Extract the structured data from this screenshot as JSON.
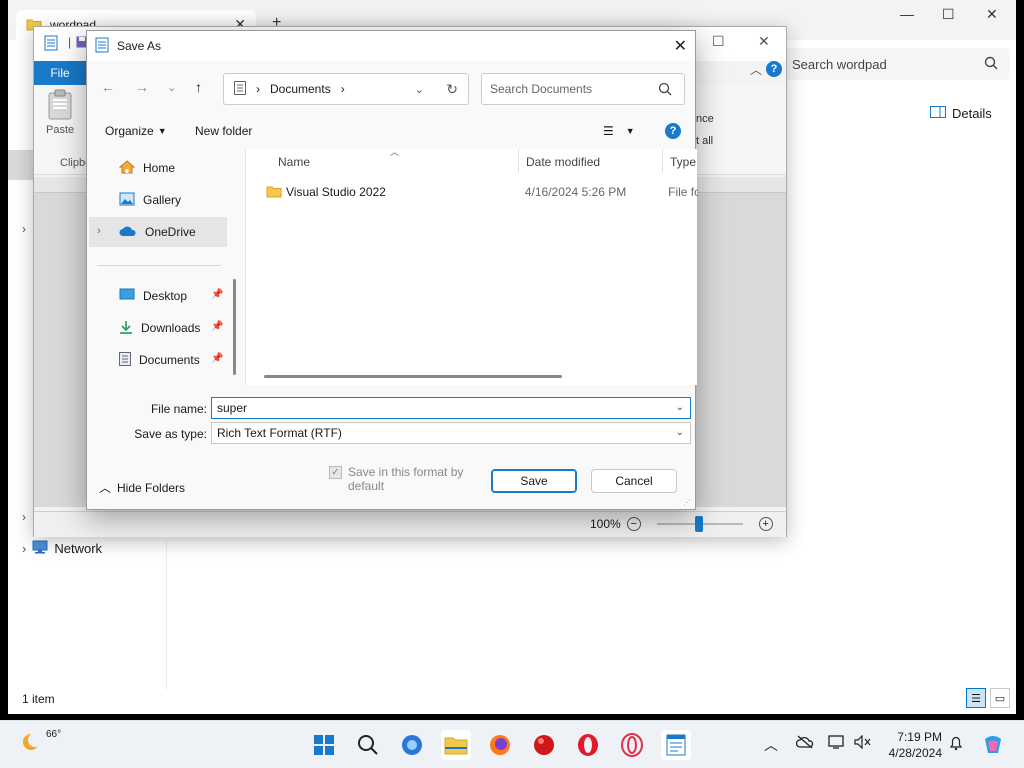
{
  "explorer": {
    "tab_title": "wordpad",
    "search_placeholder": "Search wordpad",
    "details_label": "Details",
    "network_label": "Network",
    "status_text": "1 item"
  },
  "wordpad": {
    "file_tab": "File",
    "paste_label": "Paste",
    "clipboard_label": "Clipbo",
    "ribbon_partial_1": "nce",
    "ribbon_partial_2": "t all",
    "zoom_level": "100%",
    "zoom_fraction": 0.45
  },
  "dialog": {
    "title": "Save As",
    "breadcrumb": "Documents",
    "search_placeholder": "Search Documents",
    "organize_label": "Organize",
    "new_folder_label": "New folder",
    "nav_items": [
      {
        "label": "Home",
        "icon": "home-icon"
      },
      {
        "label": "Gallery",
        "icon": "gallery-icon"
      },
      {
        "label": "OneDrive",
        "icon": "cloud-icon"
      },
      {
        "label": "Desktop",
        "icon": "desktop-icon"
      },
      {
        "label": "Downloads",
        "icon": "download-icon"
      },
      {
        "label": "Documents",
        "icon": "documents-icon"
      }
    ],
    "columns": [
      "Name",
      "Date modified",
      "Type"
    ],
    "files": [
      {
        "name": "Visual Studio 2022",
        "date": "4/16/2024 5:26 PM",
        "type": "File fo"
      }
    ],
    "file_name_label": "File name:",
    "file_name_value": "super",
    "save_as_type_label": "Save as type:",
    "save_as_type_value": "Rich Text Format (RTF)",
    "hide_folders_label": "Hide Folders",
    "save_in_format_label": "Save in this format by default",
    "save_button": "Save",
    "cancel_button": "Cancel"
  },
  "taskbar": {
    "weather_temp": "66°",
    "time": "7:19 PM",
    "date": "4/28/2024"
  },
  "colors": {
    "accent": "#1979ca",
    "taskbar_bg": "#eef1f5"
  }
}
